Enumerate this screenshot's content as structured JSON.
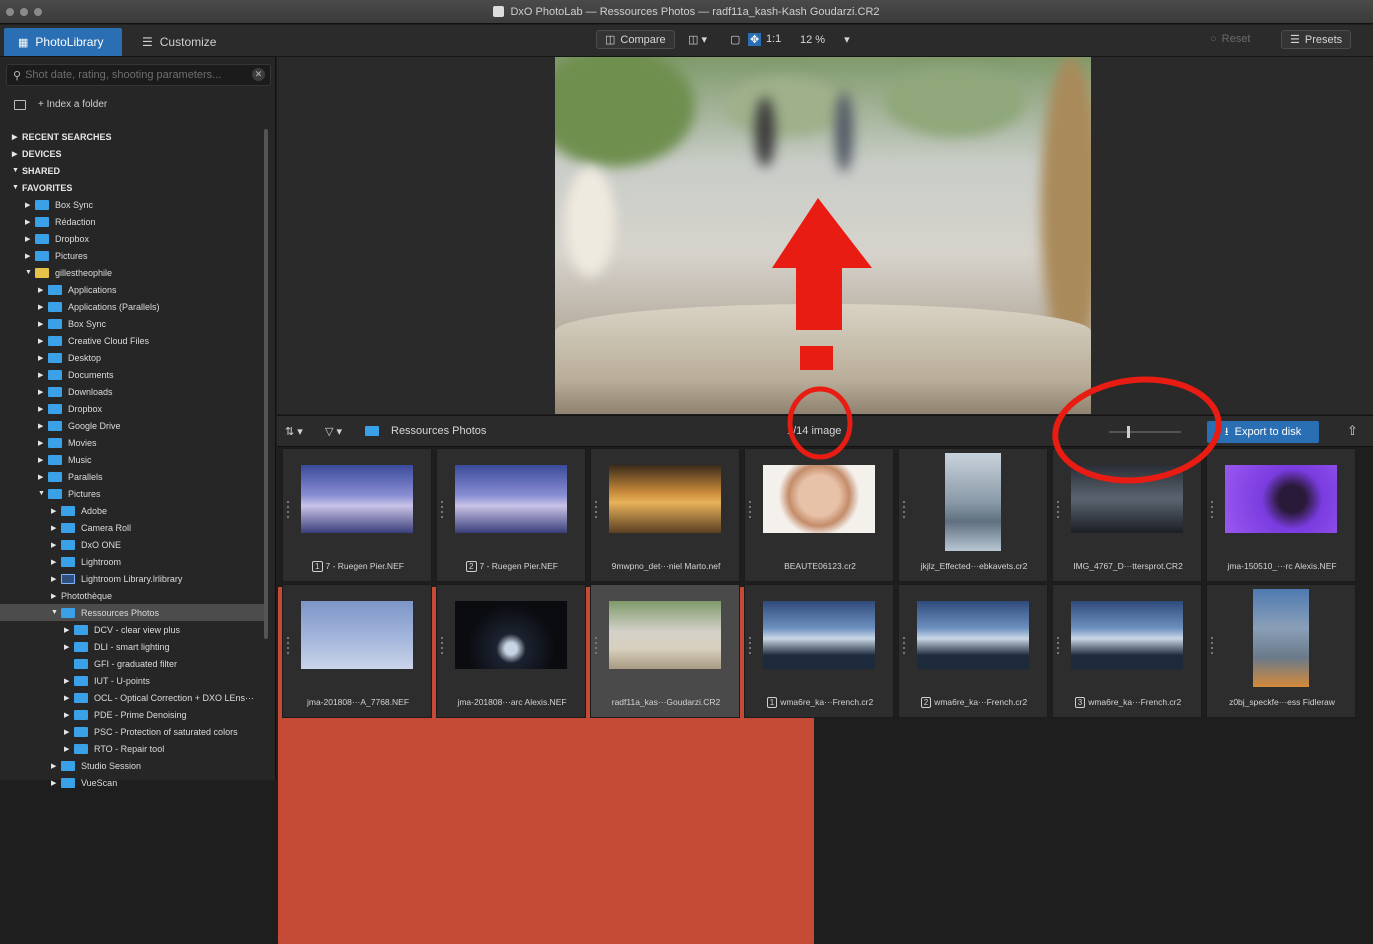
{
  "window": {
    "title": "DxO PhotoLab — Ressources Photos — radf11a_kash-Kash Goudarzi.CR2"
  },
  "tabs": [
    {
      "label": "PhotoLibrary"
    },
    {
      "label": "Customize"
    }
  ],
  "toolbar": {
    "compare": "Compare",
    "one_to_one": "1:1",
    "zoom": "12 %",
    "reset": "Reset",
    "presets": "Presets"
  },
  "sidebar": {
    "search_placeholder": "Shot date, rating, shooting parameters...",
    "index_label": "+ Index a folder",
    "rows": [
      {
        "label": "RECENT SEARCHES",
        "level": 0,
        "hdr": true,
        "open": false,
        "icon": "none"
      },
      {
        "label": "DEVICES",
        "level": 0,
        "hdr": true,
        "open": false,
        "icon": "none"
      },
      {
        "label": "SHARED",
        "level": 0,
        "hdr": true,
        "open": true,
        "icon": "none"
      },
      {
        "label": "FAVORITES",
        "level": 0,
        "hdr": true,
        "open": true,
        "icon": "none"
      },
      {
        "label": "Box Sync",
        "level": 1,
        "open": false,
        "icon": "folder"
      },
      {
        "label": "Rédaction",
        "level": 1,
        "open": false,
        "icon": "folder"
      },
      {
        "label": "Dropbox",
        "level": 1,
        "open": false,
        "icon": "folder"
      },
      {
        "label": "Pictures",
        "level": 1,
        "open": false,
        "icon": "folder"
      },
      {
        "label": "gillestheophile",
        "level": 1,
        "open": true,
        "icon": "home"
      },
      {
        "label": "Applications",
        "level": 2,
        "open": false,
        "icon": "folder"
      },
      {
        "label": "Applications (Parallels)",
        "level": 2,
        "open": false,
        "icon": "folder"
      },
      {
        "label": "Box Sync",
        "level": 2,
        "open": false,
        "icon": "folder"
      },
      {
        "label": "Creative Cloud Files",
        "level": 2,
        "open": false,
        "icon": "folder"
      },
      {
        "label": "Desktop",
        "level": 2,
        "open": false,
        "icon": "folder"
      },
      {
        "label": "Documents",
        "level": 2,
        "open": false,
        "icon": "folder"
      },
      {
        "label": "Downloads",
        "level": 2,
        "open": false,
        "icon": "folder"
      },
      {
        "label": "Dropbox",
        "level": 2,
        "open": false,
        "icon": "folder"
      },
      {
        "label": "Google Drive",
        "level": 2,
        "open": false,
        "icon": "folder"
      },
      {
        "label": "Movies",
        "level": 2,
        "open": false,
        "icon": "folder"
      },
      {
        "label": "Music",
        "level": 2,
        "open": false,
        "icon": "folder"
      },
      {
        "label": "Parallels",
        "level": 2,
        "open": false,
        "icon": "folder"
      },
      {
        "label": "Pictures",
        "level": 2,
        "open": true,
        "icon": "folder"
      },
      {
        "label": "Adobe",
        "level": 3,
        "open": false,
        "icon": "folder"
      },
      {
        "label": "Camera Roll",
        "level": 3,
        "open": false,
        "icon": "folder"
      },
      {
        "label": "DxO ONE",
        "level": 3,
        "open": false,
        "icon": "folder"
      },
      {
        "label": "Lightroom",
        "level": 3,
        "open": false,
        "icon": "folder"
      },
      {
        "label": "Lightroom Library.lrlibrary",
        "level": 3,
        "open": false,
        "icon": "lr"
      },
      {
        "label": "Photothèque",
        "level": 3,
        "open": false,
        "icon": "photo"
      },
      {
        "label": "Ressources Photos",
        "level": 3,
        "open": true,
        "icon": "folder",
        "selected": true
      },
      {
        "label": "DCV - clear view plus",
        "level": 4,
        "open": false,
        "icon": "folder"
      },
      {
        "label": "DLI - smart lighting",
        "level": 4,
        "open": false,
        "icon": "folder"
      },
      {
        "label": "GFI - graduated filter",
        "level": 4,
        "open": null,
        "icon": "folder"
      },
      {
        "label": "IUT - U-points",
        "level": 4,
        "open": false,
        "icon": "folder"
      },
      {
        "label": "OCL - Optical Correction + DXO LEns···",
        "level": 4,
        "open": false,
        "icon": "folder"
      },
      {
        "label": "PDE - Prime Denoising",
        "level": 4,
        "open": false,
        "icon": "folder"
      },
      {
        "label": "PSC - Protection of saturated colors",
        "level": 4,
        "open": false,
        "icon": "folder"
      },
      {
        "label": "RTO - Repair tool",
        "level": 4,
        "open": false,
        "icon": "folder"
      },
      {
        "label": "Studio Session",
        "level": 3,
        "open": false,
        "icon": "folder"
      },
      {
        "label": "VueScan",
        "level": 3,
        "open": false,
        "icon": "folder"
      }
    ]
  },
  "filmstrip": {
    "folder": "Ressources Photos",
    "count": "1/14 image",
    "export": "Export to disk"
  },
  "thumbnails": [
    {
      "caption": "7 - Ruegen Pier.NEF",
      "num": "1",
      "kind": "pier"
    },
    {
      "caption": "7 - Ruegen Pier.NEF",
      "num": "2",
      "kind": "pier"
    },
    {
      "caption": "9mwpno_det···niel Marto.nef",
      "num": "",
      "kind": "sunset"
    },
    {
      "caption": "BEAUTE06123.cr2",
      "num": "",
      "kind": "face"
    },
    {
      "caption": "jkjlz_Effected···ebkavets.cr2",
      "num": "",
      "kind": "castle"
    },
    {
      "caption": "IMG_4767_D···ttersprot.CR2",
      "num": "",
      "kind": "dark"
    },
    {
      "caption": "jma-150510_···rc Alexis.NEF",
      "num": "",
      "kind": "purple"
    },
    {
      "caption": "jma-201808···A_7768.NEF",
      "num": "",
      "kind": "sky"
    },
    {
      "caption": "jma-201808···arc Alexis.NEF",
      "num": "",
      "kind": "night"
    },
    {
      "caption": "radf11a_kas···Goudarzi.CR2",
      "num": "",
      "kind": "fountain",
      "selected": true
    },
    {
      "caption": "wma6re_ka···French.cr2",
      "num": "1",
      "kind": "rocks"
    },
    {
      "caption": "wma6re_ka···French.cr2",
      "num": "2",
      "kind": "rocks"
    },
    {
      "caption": "wma6re_ka···French.cr2",
      "num": "3",
      "kind": "rocks"
    },
    {
      "caption": "z0bj_speckfe···ess Fidleraw",
      "num": "",
      "kind": "city"
    }
  ],
  "colors": {
    "accent": "#2a6fb4",
    "annotation": "#e81c12",
    "folder": "#3aa0e8"
  }
}
